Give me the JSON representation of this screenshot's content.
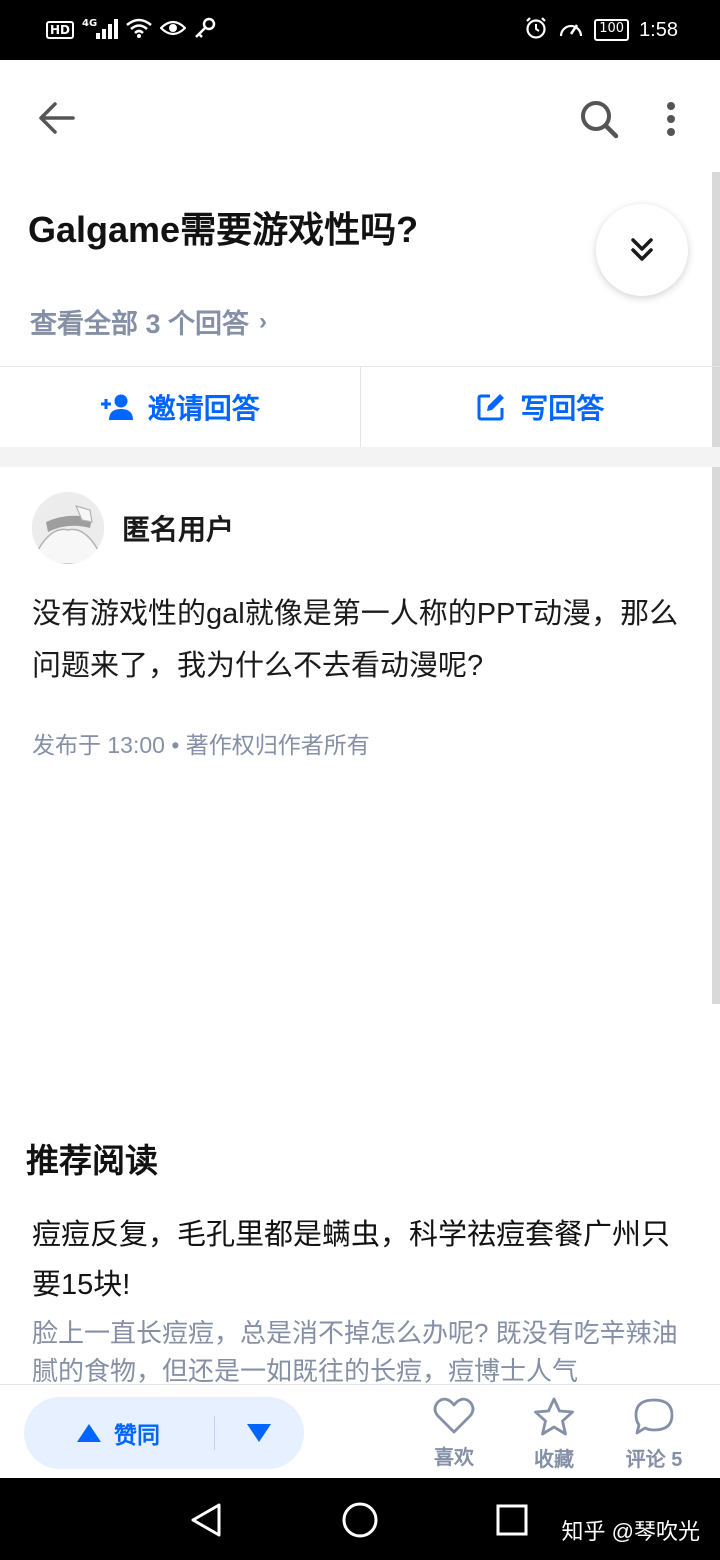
{
  "status_bar": {
    "hd": "HD",
    "network": "4G",
    "battery": "100",
    "time": "1:58"
  },
  "question": {
    "title": "Galgame需要游戏性吗?",
    "view_all": "查看全部 3 个回答"
  },
  "actions": {
    "invite": "邀请回答",
    "write": "写回答"
  },
  "answer": {
    "author": "匿名用户",
    "text": "没有游戏性的gal就像是第一人称的PPT动漫，那么问题来了，我为什么不去看动漫呢?",
    "meta": "发布于 13:00 • 著作权归作者所有"
  },
  "recommend": {
    "title": "推荐阅读",
    "item": {
      "headline": "痘痘反复，毛孔里都是螨虫，科学祛痘套餐广州只要15块!",
      "desc": "脸上一直长痘痘，总是消不掉怎么办呢? 既没有吃辛辣油腻的食物，但还是一如既往的长痘，痘博士人气"
    }
  },
  "bottom_bar": {
    "upvote": "赞同",
    "like": "喜欢",
    "collect": "收藏",
    "comment": "评论 5"
  },
  "watermark": "知乎 @琴吹光",
  "colors": {
    "accent": "#0066ff",
    "secondary_text": "#8590a6"
  }
}
